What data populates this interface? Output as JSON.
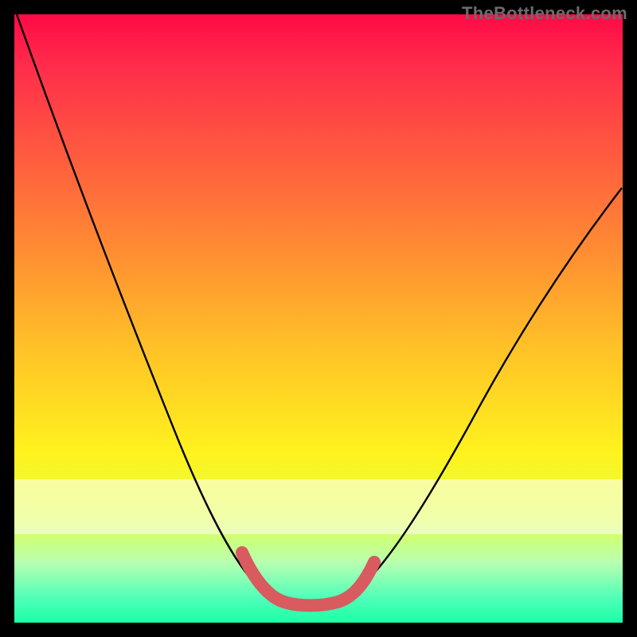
{
  "watermark": "TheBottleneck.com",
  "chart_data": {
    "type": "line",
    "title": "",
    "xlabel": "",
    "ylabel": "",
    "xlim": [
      0,
      100
    ],
    "ylim": [
      0,
      100
    ],
    "series": [
      {
        "name": "bottleneck-curve",
        "x": [
          0,
          5,
          10,
          15,
          20,
          25,
          30,
          35,
          38,
          40,
          43,
          47,
          50,
          53,
          56,
          60,
          65,
          70,
          75,
          80,
          85,
          90,
          95,
          100
        ],
        "values": [
          100,
          90,
          80,
          70,
          59,
          48,
          37,
          25,
          15,
          9,
          5,
          3,
          3,
          3,
          5,
          9,
          17,
          26,
          35,
          43,
          51,
          58,
          65,
          72
        ]
      },
      {
        "name": "sweet-spot-marker",
        "x": [
          38,
          40,
          43,
          47,
          50,
          53,
          56
        ],
        "values": [
          10,
          6,
          4,
          3,
          3,
          4,
          7
        ]
      }
    ],
    "annotations": []
  }
}
